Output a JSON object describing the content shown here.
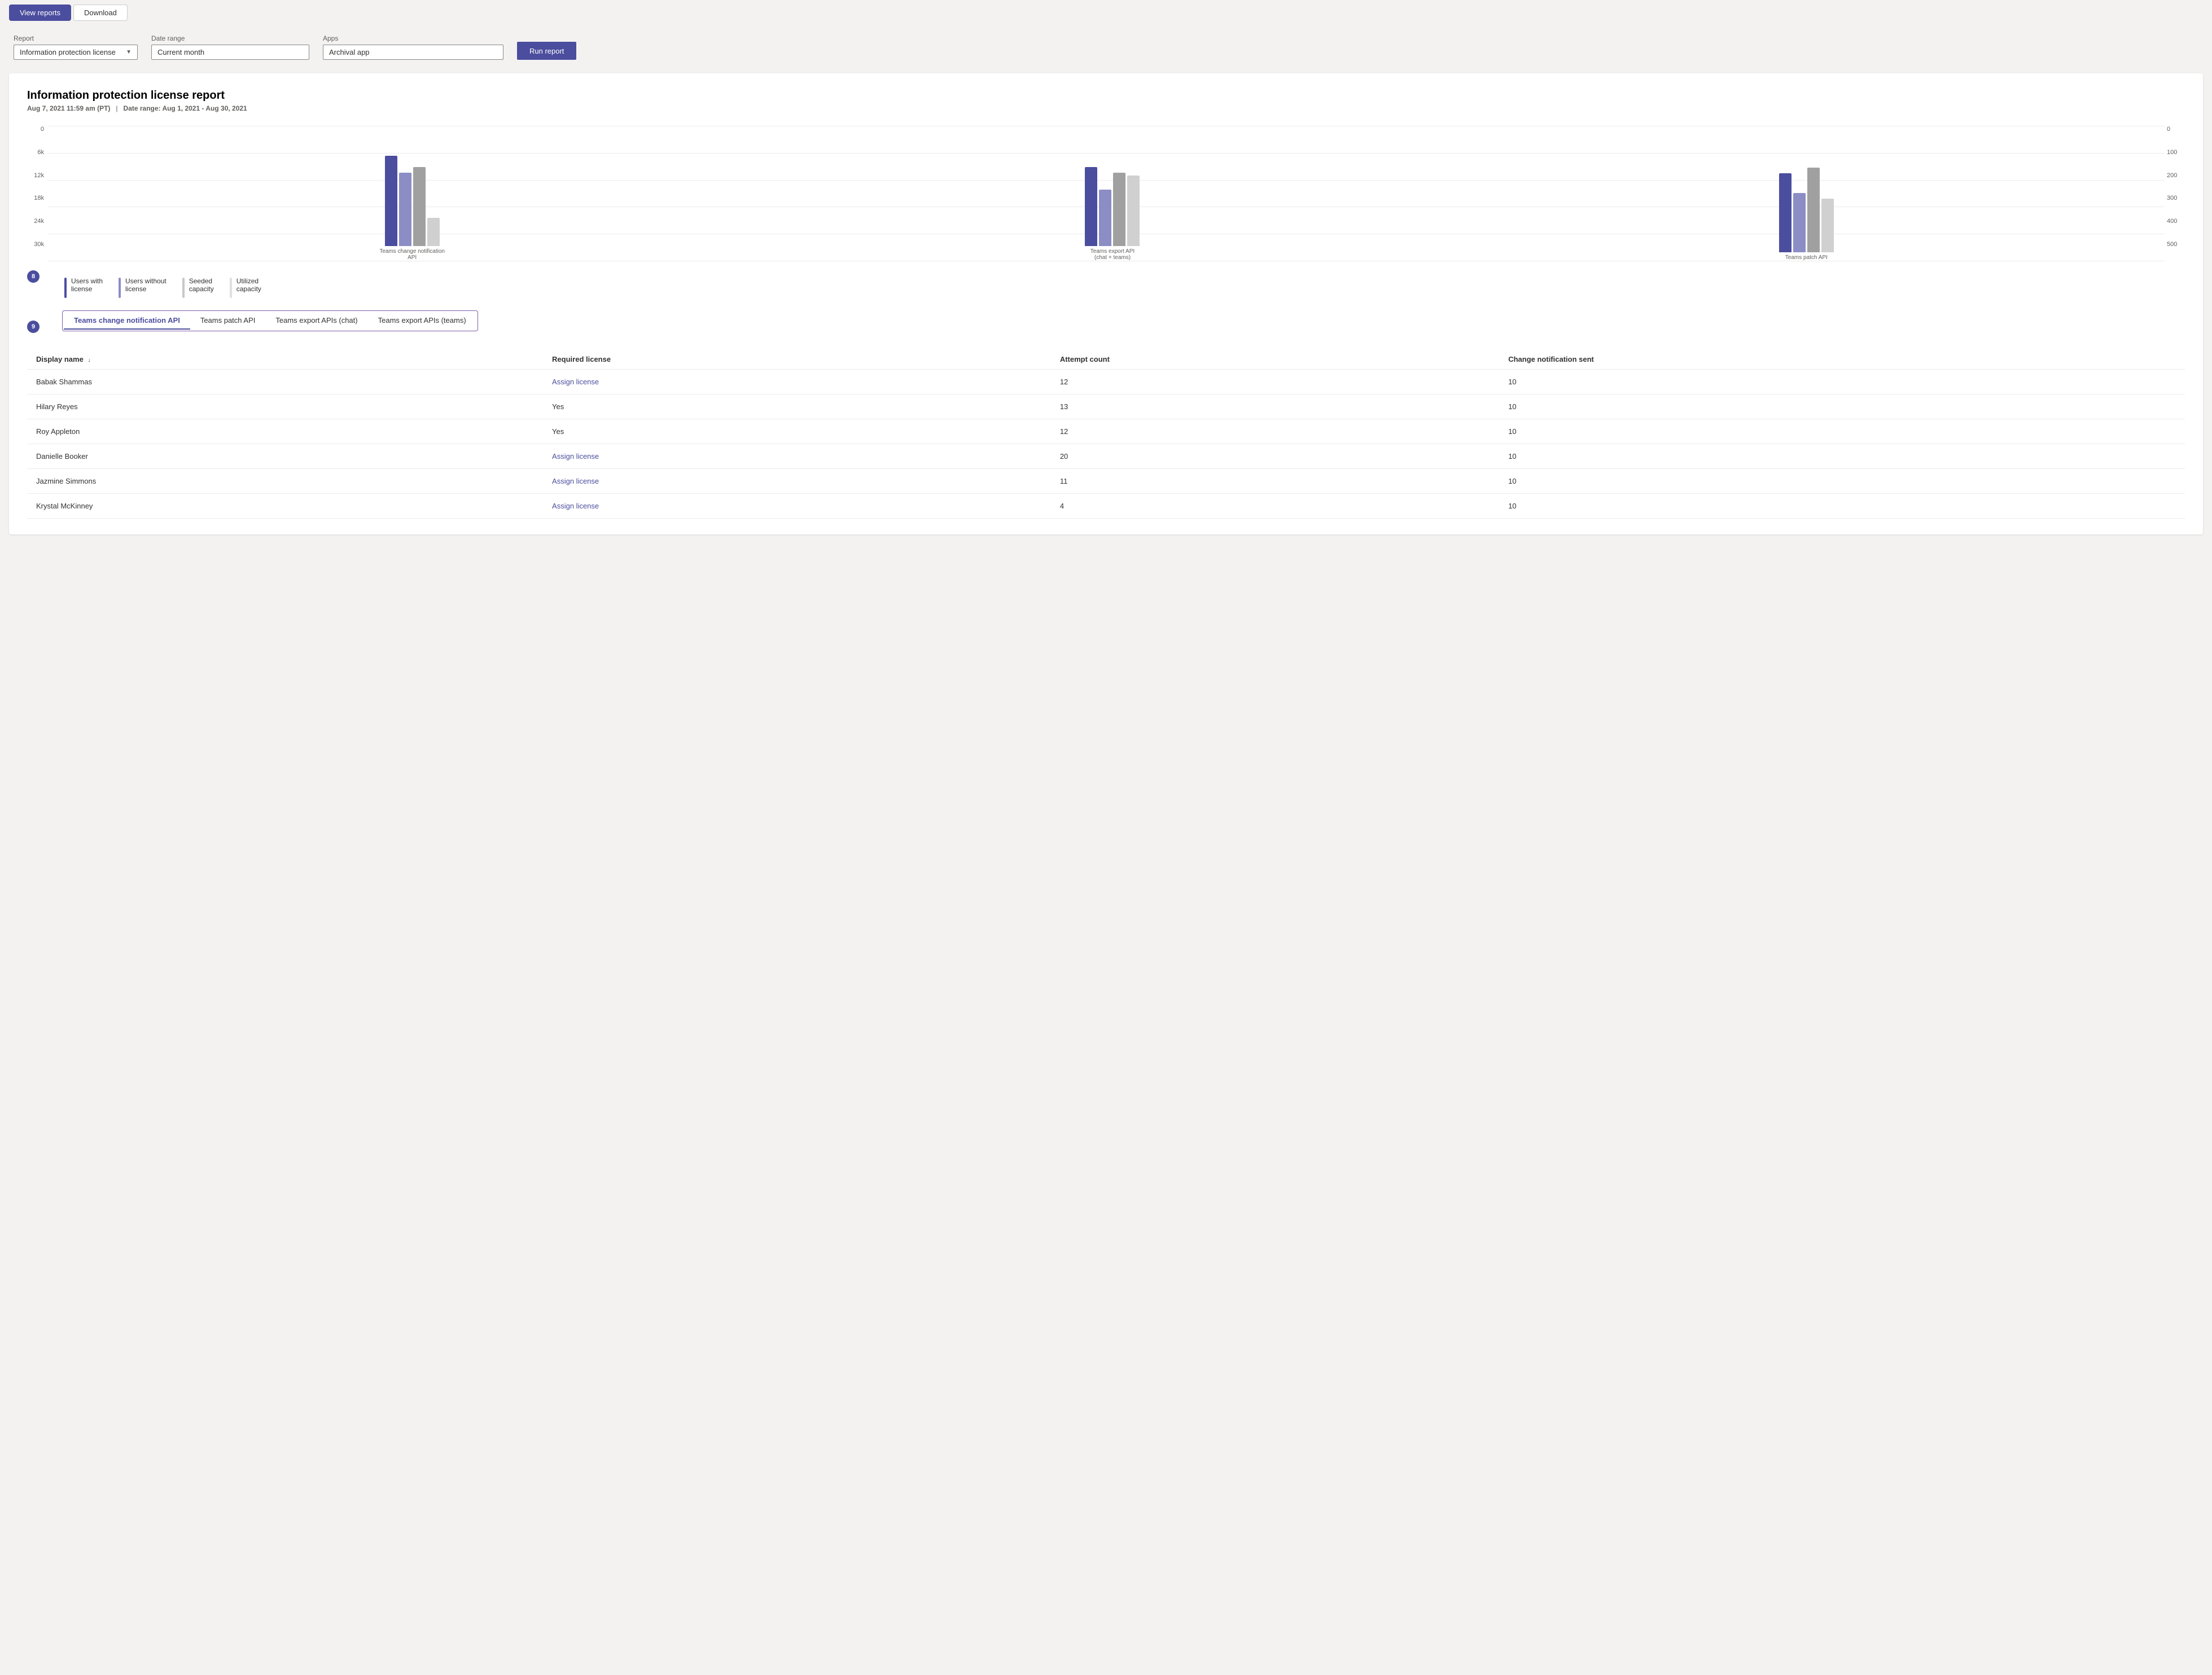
{
  "toolbar": {
    "view_reports_label": "View reports",
    "download_label": "Download"
  },
  "filters": {
    "report_label": "Report",
    "report_value": "Information protection license",
    "date_range_label": "Date range",
    "date_range_value": "Current month",
    "apps_label": "Apps",
    "apps_value": "Archival app",
    "run_report_label": "Run report"
  },
  "report": {
    "title": "Information protection license report",
    "generated_at": "Aug 7, 2021 11:59 am (PT)",
    "separator": "|",
    "date_range_label": "Date range:",
    "date_range_value": "Aug 1, 2021 - Aug 30, 2021",
    "chart": {
      "y_left": [
        "0",
        "6k",
        "12k",
        "18k",
        "24k",
        "30k"
      ],
      "y_right": [
        "0",
        "100",
        "200",
        "300",
        "400",
        "500"
      ],
      "groups": [
        {
          "label": "Teams change notification API",
          "bars": [
            {
              "color": "dark-blue",
              "height": 160
            },
            {
              "color": "medium-blue",
              "height": 130
            },
            {
              "color": "gray",
              "height": 140
            },
            {
              "color": "light-gray",
              "height": 50
            }
          ]
        },
        {
          "label": "Teams export API\n(chat + teams)",
          "bars": [
            {
              "color": "dark-blue",
              "height": 140
            },
            {
              "color": "medium-blue",
              "height": 100
            },
            {
              "color": "gray",
              "height": 130
            },
            {
              "color": "light-gray",
              "height": 125
            }
          ]
        },
        {
          "label": "Teams patch API",
          "bars": [
            {
              "color": "dark-blue",
              "height": 140
            },
            {
              "color": "medium-blue",
              "height": 105
            },
            {
              "color": "gray",
              "height": 150
            },
            {
              "color": "light-gray",
              "height": 95
            }
          ]
        }
      ]
    },
    "legend": [
      {
        "color": "dark-blue",
        "label_line1": "Users with",
        "label_line2": "license"
      },
      {
        "color": "medium-blue",
        "label_line1": "Users without",
        "label_line2": "license"
      },
      {
        "color": "light-gray-bar",
        "label_line1": "Seeded",
        "label_line2": "capacity"
      },
      {
        "color": "lighter-gray",
        "label_line1": "Utilized",
        "label_line2": "capacity"
      }
    ],
    "step8_badge": "8",
    "step9_badge": "9",
    "tabs": [
      {
        "label": "Teams change notification API",
        "active": true
      },
      {
        "label": "Teams patch API",
        "active": false
      },
      {
        "label": "Teams export APIs (chat)",
        "active": false
      },
      {
        "label": "Teams export APIs (teams)",
        "active": false
      }
    ],
    "table": {
      "columns": [
        {
          "label": "Display name",
          "sort": "↓"
        },
        {
          "label": "Required license",
          "sort": ""
        },
        {
          "label": "Attempt count",
          "sort": ""
        },
        {
          "label": "Change notification sent",
          "sort": ""
        }
      ],
      "rows": [
        {
          "name": "Babak Shammas",
          "license": "Assign license",
          "is_link": true,
          "attempts": "12",
          "sent": "10"
        },
        {
          "name": "Hilary Reyes",
          "license": "Yes",
          "is_link": false,
          "attempts": "13",
          "sent": "10"
        },
        {
          "name": "Roy Appleton",
          "license": "Yes",
          "is_link": false,
          "attempts": "12",
          "sent": "10"
        },
        {
          "name": "Danielle Booker",
          "license": "Assign license",
          "is_link": true,
          "attempts": "20",
          "sent": "10"
        },
        {
          "name": "Jazmine Simmons",
          "license": "Assign license",
          "is_link": true,
          "attempts": "11",
          "sent": "10"
        },
        {
          "name": "Krystal McKinney",
          "license": "Assign license",
          "is_link": true,
          "attempts": "4",
          "sent": "10"
        }
      ]
    }
  }
}
